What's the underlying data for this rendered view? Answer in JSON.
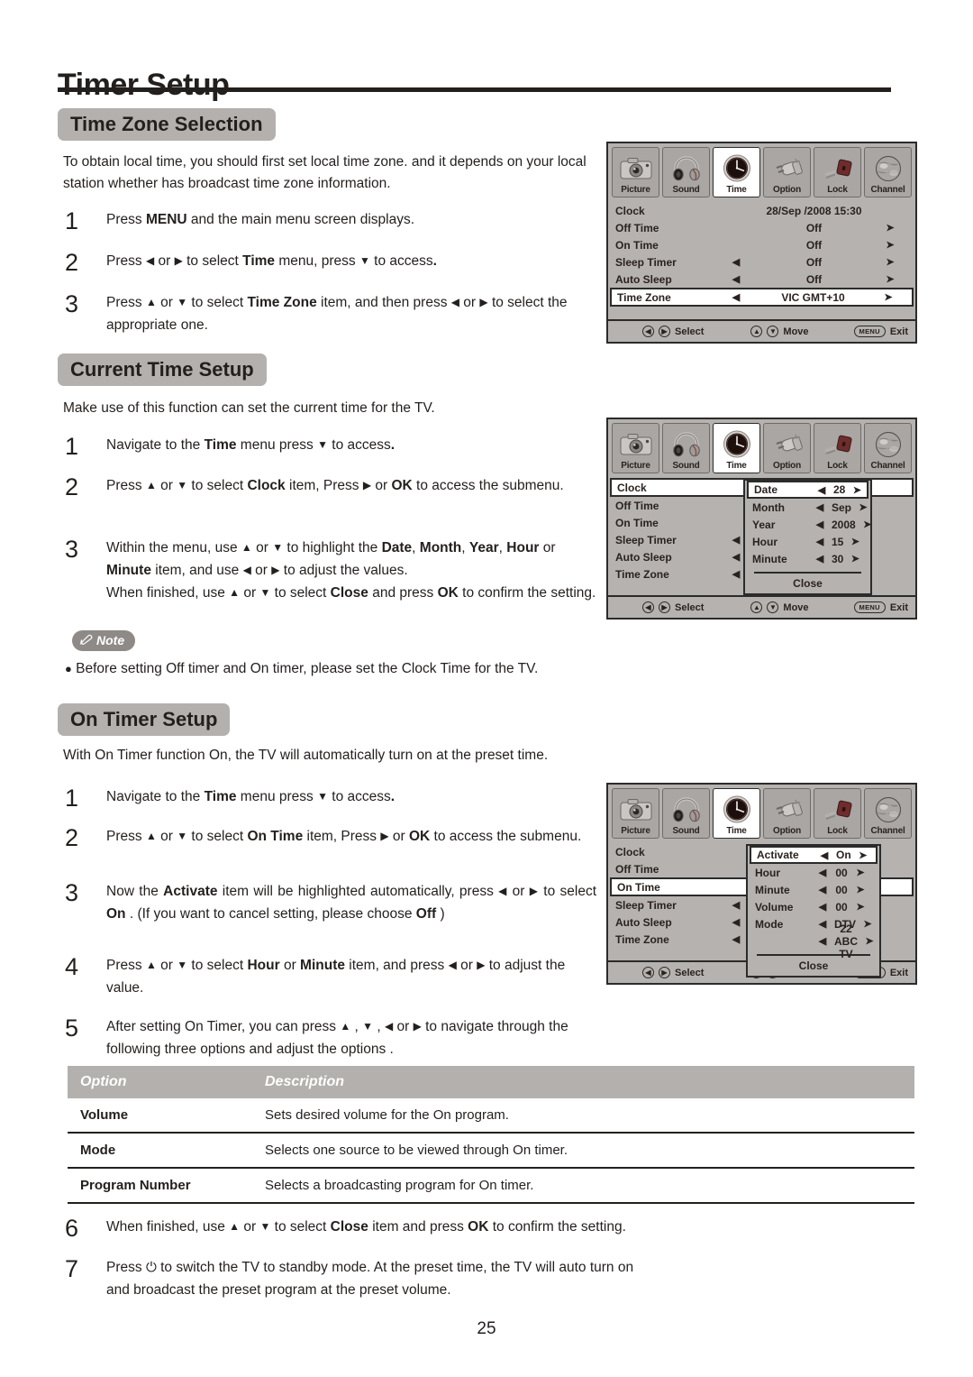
{
  "document": {
    "page_title": "Timer Setup",
    "page_number": "25"
  },
  "sections": {
    "time_zone": {
      "heading": "Time Zone Selection",
      "intro": "To obtain local time, you should first set local time zone. and it depends on your local station whether has broadcast time zone information.",
      "steps": [
        {
          "num": "1",
          "html": "Press <b>MENU</b> and the main menu screen displays."
        },
        {
          "num": "2",
          "html": "Press <span class=\"arw\">◀</span> or <span class=\"arw\">▶</span> to select <b>Time</b> menu,  press <span class=\"arw\">▼</span> to access<b>.</b>"
        },
        {
          "num": "3",
          "html": "Press <span class=\"arw\">▲</span> or <span class=\"arw\">▼</span> to select <b>Time Zone</b> item, and then press <span class=\"arw\">◀</span> or <span class=\"arw\">▶</span> to select the appropriate one."
        }
      ]
    },
    "current_time": {
      "heading": "Current Time Setup",
      "intro": "Make use of this function can set the current time for the TV.",
      "steps": [
        {
          "num": "1",
          "html": "Navigate to the <b>Time</b> menu  press <span class=\"arw\">▼</span> to access<b>.</b>"
        },
        {
          "num": "2",
          "html": "Press <span class=\"arw\">▲</span> or <span class=\"arw\">▼</span> to select <b>Clock</b> item, Press <span class=\"arw\">▶</span> or <b>OK</b> to access the submenu."
        },
        {
          "num": "3",
          "html": "Within the menu, use <span class=\"arw\">▲</span> or <span class=\"arw\">▼</span> to highlight the <b>Date</b>, <b>Month</b>, <b>Year</b>, <b>Hour</b> or <b>Minute</b> item, and use <span class=\"arw\">◀</span> or <span class=\"arw\">▶</span> to adjust the values.<br>When finished, use <span class=\"arw\">▲</span> or <span class=\"arw\">▼</span> to select <b>Close</b> and press <b>OK</b> to confirm the setting."
        }
      ]
    },
    "note": {
      "badge_label": "Note",
      "text": "Before setting Off timer and On timer, please set the Clock Time for the TV."
    },
    "on_timer": {
      "heading": "On Timer Setup",
      "intro": "With On Timer function On, the TV will automatically turn on at the preset time.",
      "steps": [
        {
          "num": "1",
          "html": "Navigate to the <b>Time</b> menu  press <span class=\"arw\">▼</span> to access<b>.</b>"
        },
        {
          "num": "2",
          "html": "Press <span class=\"arw\">▲</span> or <span class=\"arw\">▼</span> to select <b>On Time</b> item, Press <span class=\"arw\">▶</span> or <b>OK</b> to access the submenu."
        },
        {
          "num": "3",
          "html": "Now the <b>Activate</b> item will be highlighted automatically, press <span class=\"arw\">◀</span> or <span class=\"arw\">▶</span> to select <b>On</b> . (If you want to cancel setting, please choose <b>Off</b> )"
        },
        {
          "num": "4",
          "html": "Press <span class=\"arw\">▲</span> or <span class=\"arw\">▼</span> to select <b>Hour</b> or <b>Minute</b> item, and press <span class=\"arw\">◀</span> or <span class=\"arw\">▶</span> to adjust the value."
        },
        {
          "num": "5",
          "html": "After setting On Timer, you can press <span class=\"arw\">▲</span> , <span class=\"arw\">▼</span> , <span class=\"arw\">◀</span> or <span class=\"arw\">▶</span> to navigate through the following three options and adjust the options ."
        },
        {
          "num": "6",
          "html": "When finished, use <span class=\"arw\">▲</span> or <span class=\"arw\">▼</span> to select <b>Close</b> item and press <b>OK</b> to confirm the setting."
        },
        {
          "num": "7",
          "html": "Press <span style=\"font-size:15px\">⏻</span> to switch the TV to standby mode. At the preset time, the TV will auto turn on and broadcast the preset program at the preset volume."
        }
      ]
    }
  },
  "options_table": {
    "headers": [
      "Option",
      "Description"
    ],
    "rows": [
      {
        "option": "Volume",
        "description": "Sets desired volume for the On program."
      },
      {
        "option": "Mode",
        "description": "Selects one source to be viewed through On timer."
      },
      {
        "option": "Program Number",
        "description": "Selects a broadcasting program for On timer."
      }
    ]
  },
  "osd": {
    "tabs": [
      {
        "label": "Picture",
        "icon": "camera-icon",
        "active": false
      },
      {
        "label": "Sound",
        "icon": "headphones-icon",
        "active": false
      },
      {
        "label": "Time",
        "icon": "clock-icon",
        "active": true
      },
      {
        "label": "Option",
        "icon": "plug-icon",
        "active": false
      },
      {
        "label": "Lock",
        "icon": "padlock-icon",
        "active": false
      },
      {
        "label": "Channel",
        "icon": "globe-icon",
        "active": false
      }
    ],
    "footer": [
      {
        "keys": "◀▶",
        "label": "Select"
      },
      {
        "keys": "▲▼",
        "label": "Move"
      },
      {
        "keys": "MENU",
        "label": "Exit"
      }
    ],
    "screen1": {
      "rows": [
        {
          "name": "Clock",
          "left": "",
          "value": "28/Sep /2008 15:30",
          "right": "",
          "selected": false,
          "wide_value": true
        },
        {
          "name": "Off Time",
          "left": "",
          "value": "Off",
          "right": "➤",
          "selected": false
        },
        {
          "name": "On Time",
          "left": "",
          "value": "Off",
          "right": "➤",
          "selected": false
        },
        {
          "name": "Sleep Timer",
          "left": "◀",
          "value": "Off",
          "right": "➤",
          "selected": false
        },
        {
          "name": "Auto Sleep",
          "left": "◀",
          "value": "Off",
          "right": "➤",
          "selected": false
        },
        {
          "name": "Time Zone",
          "left": "◀",
          "value": "VIC GMT+10",
          "right": "➤",
          "selected": true
        }
      ]
    },
    "screen2": {
      "rows": [
        {
          "name": "Clock",
          "left": "",
          "value": "",
          "right": "",
          "selected": true
        },
        {
          "name": "Off Time",
          "left": "",
          "value": "",
          "right": "",
          "selected": false
        },
        {
          "name": "On Time",
          "left": "",
          "value": "",
          "right": "",
          "selected": false
        },
        {
          "name": "Sleep Timer",
          "left": "◀",
          "value": "",
          "right": "",
          "selected": false
        },
        {
          "name": "Auto Sleep",
          "left": "◀",
          "value": "",
          "right": "",
          "selected": false
        },
        {
          "name": "Time Zone",
          "left": "◀",
          "value": "",
          "right": "",
          "selected": false
        }
      ],
      "submenu": {
        "rows": [
          {
            "name": "Date",
            "left": "◀",
            "value": "28",
            "right": "➤",
            "selected": true
          },
          {
            "name": "Month",
            "left": "◀",
            "value": "Sep",
            "right": "➤",
            "selected": false
          },
          {
            "name": "Year",
            "left": "◀",
            "value": "2008",
            "right": "➤",
            "selected": false
          },
          {
            "name": "Hour",
            "left": "◀",
            "value": "15",
            "right": "➤",
            "selected": false
          },
          {
            "name": "Minute",
            "left": "◀",
            "value": "30",
            "right": "➤",
            "selected": false
          }
        ],
        "close_label": "Close"
      }
    },
    "screen3": {
      "rows": [
        {
          "name": "Clock",
          "left": "",
          "value": "",
          "right": "",
          "selected": false
        },
        {
          "name": "Off Time",
          "left": "",
          "value": "",
          "right": "",
          "selected": false
        },
        {
          "name": "On Time",
          "left": "",
          "value": "",
          "right": "",
          "selected": true
        },
        {
          "name": "Sleep Timer",
          "left": "◀",
          "value": "",
          "right": "",
          "selected": false
        },
        {
          "name": "Auto Sleep",
          "left": "◀",
          "value": "",
          "right": "",
          "selected": false
        },
        {
          "name": "Time Zone",
          "left": "◀",
          "value": "",
          "right": "",
          "selected": false
        }
      ],
      "submenu": {
        "rows": [
          {
            "name": "Activate",
            "left": "◀",
            "value": "On",
            "right": "➤",
            "selected": true
          },
          {
            "name": "Hour",
            "left": "◀",
            "value": "00",
            "right": "➤",
            "selected": false
          },
          {
            "name": "Minute",
            "left": "◀",
            "value": "00",
            "right": "➤",
            "selected": false
          },
          {
            "name": "Volume",
            "left": "◀",
            "value": "00",
            "right": "➤",
            "selected": false
          },
          {
            "name": "Mode",
            "left": "◀",
            "value": "DTV",
            "right": "➤",
            "selected": false
          },
          {
            "name": "",
            "left": "◀",
            "value": "22 ABC TV",
            "right": "➤",
            "selected": false
          }
        ],
        "close_label": "Close"
      }
    }
  }
}
